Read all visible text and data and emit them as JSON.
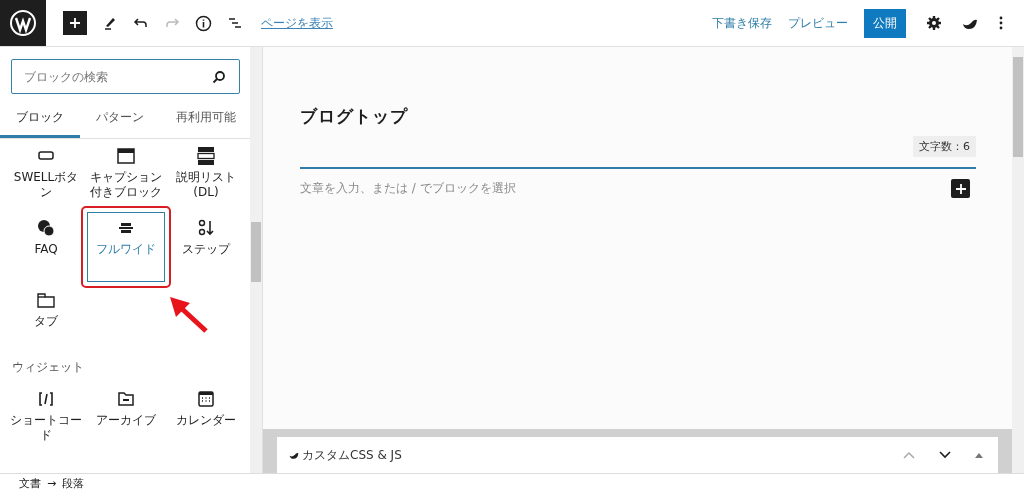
{
  "toolbar": {
    "view_link": "ページを表示",
    "save_draft": "下書き保存",
    "preview": "プレビュー",
    "publish": "公開"
  },
  "inserter": {
    "search": {
      "placeholder": "ブロックの検索"
    },
    "tabs": [
      {
        "label": "ブロック",
        "selected": true
      },
      {
        "label": "パターン",
        "selected": false
      },
      {
        "label": "再利用可能",
        "selected": false
      }
    ],
    "groups": [
      {
        "blocks": [
          {
            "label": "SWELLボタン",
            "selected": false,
            "highlighted": false
          },
          {
            "label": "キャプション付きブロック",
            "selected": false,
            "highlighted": false
          },
          {
            "label": "説明リスト(DL)",
            "selected": false,
            "highlighted": false
          },
          {
            "label": "FAQ",
            "selected": false,
            "highlighted": false
          },
          {
            "label": "フルワイド",
            "selected": true,
            "highlighted": true
          },
          {
            "label": "ステップ",
            "selected": false,
            "highlighted": false
          },
          {
            "label": "タブ",
            "selected": false,
            "highlighted": false
          }
        ]
      },
      {
        "heading": "ウィジェット",
        "blocks": [
          {
            "label": "ショートコード",
            "selected": false,
            "highlighted": false
          },
          {
            "label": "アーカイブ",
            "selected": false,
            "highlighted": false
          },
          {
            "label": "カレンダー",
            "selected": false,
            "highlighted": false
          }
        ]
      }
    ]
  },
  "editor": {
    "title": "ブログトップ",
    "char_count": "文字数：6",
    "placeholder": "文章を入力、または / でブロックを選択"
  },
  "meta_box": {
    "title": "カスタムCSS & JS"
  },
  "breadcrumb": {
    "items": [
      "文書",
      "段落"
    ],
    "separator": "→"
  }
}
